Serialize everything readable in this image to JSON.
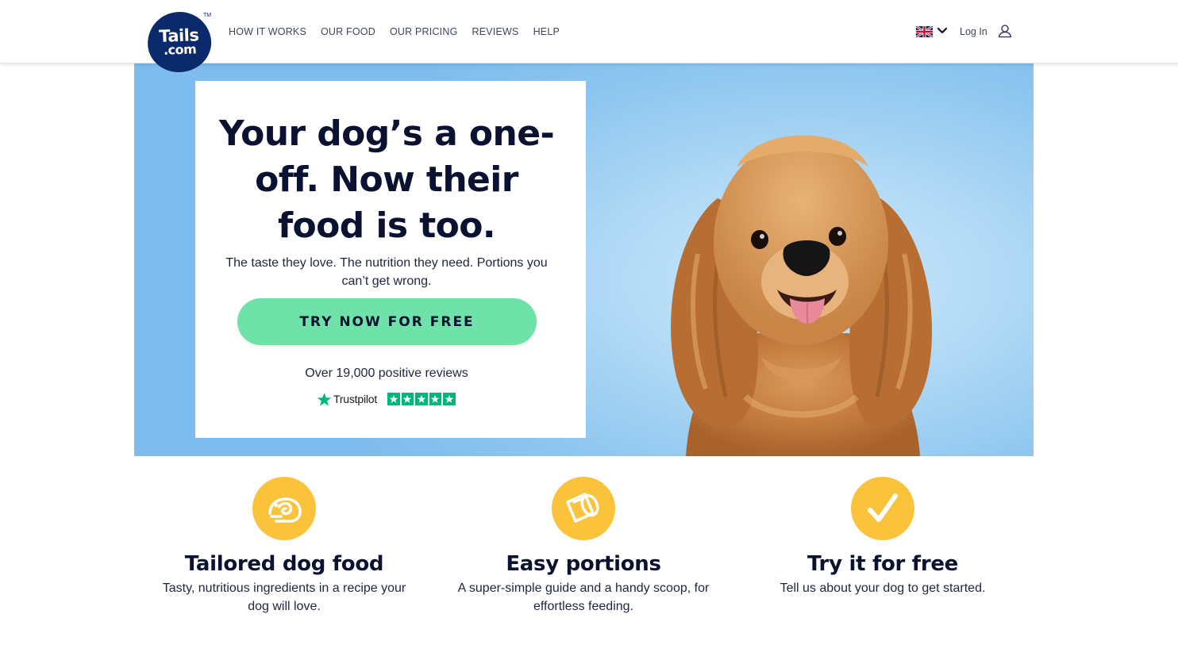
{
  "header": {
    "logo": {
      "line1": "Tails",
      "line2": ".com",
      "trademark": "TM"
    },
    "nav": [
      {
        "label": "HOW IT WORKS"
      },
      {
        "label": "OUR FOOD"
      },
      {
        "label": "OUR PRICING"
      },
      {
        "label": "REVIEWS"
      },
      {
        "label": "HELP"
      }
    ],
    "country_flag_icon": "uk-flag-icon",
    "login_label": "Log In",
    "account_icon": "user-icon"
  },
  "hero": {
    "title": "Your dog’s a one-off. Now their food is too.",
    "title_lines": [
      "Your dog’s a one-",
      "off. Now their",
      "food is too."
    ],
    "subtitle": "The taste they love. The nutrition they need. Portions you can’t get wrong.",
    "cta_label": "TRY NOW FOR FREE",
    "reviews_text": "Over 19,000 positive reviews",
    "trustpilot_label": "Trustpilot",
    "trustpilot_rating": 5,
    "image_icon": "cocker-spaniel-photo",
    "colors": {
      "background": "#8cc5ef",
      "cta": "#6ee2a8",
      "heading": "#0b1131"
    }
  },
  "features": [
    {
      "icon": "food-icon",
      "title": "Tailored dog food",
      "text": "Tasty, nutritious ingredients in a recipe your dog will love."
    },
    {
      "icon": "scoop-icon",
      "title": "Easy portions",
      "text": "A super-simple guide and a handy scoop, for effortless feeding."
    },
    {
      "icon": "checkmark-icon",
      "title": "Try it for free",
      "text": "Tell us about your dog to get started."
    }
  ],
  "colors": {
    "accent_yellow": "#fbc33c",
    "brand_navy": "#0b2a6b",
    "trustpilot_green": "#00b67a"
  }
}
